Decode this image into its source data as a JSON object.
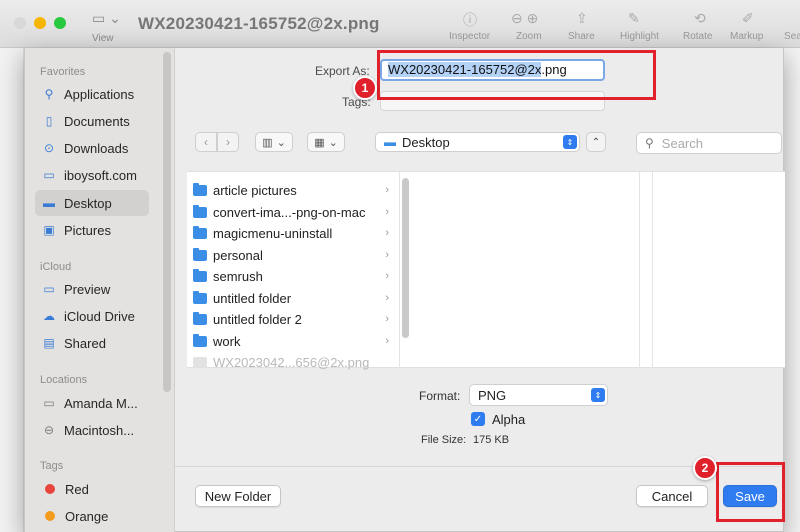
{
  "window": {
    "title": "WX20230421-165752@2x.png",
    "view_label": "View",
    "toolbar": [
      {
        "label": "Inspector",
        "icon": "info-icon"
      },
      {
        "label": "Zoom",
        "icon": "zoom-out-icon"
      },
      {
        "label": "Share",
        "icon": "share-icon"
      },
      {
        "label": "Highlight",
        "icon": "highlight-icon"
      },
      {
        "label": "Rotate",
        "icon": "rotate-icon"
      },
      {
        "label": "Markup",
        "icon": "markup-icon"
      },
      {
        "label": "Sear",
        "icon": "search-icon"
      }
    ]
  },
  "sidebar": {
    "sections": {
      "favorites": "Favorites",
      "icloud": "iCloud",
      "locations": "Locations",
      "tags": "Tags"
    },
    "favorites": [
      {
        "label": "Applications",
        "icon": "applications-icon"
      },
      {
        "label": "Documents",
        "icon": "documents-icon"
      },
      {
        "label": "Downloads",
        "icon": "downloads-icon"
      },
      {
        "label": "iboysoft.com",
        "icon": "folder-icon"
      },
      {
        "label": "Desktop",
        "icon": "desktop-icon",
        "active": true
      },
      {
        "label": "Pictures",
        "icon": "pictures-icon"
      }
    ],
    "icloud": [
      {
        "label": "Preview",
        "icon": "folder-icon"
      },
      {
        "label": "iCloud Drive",
        "icon": "cloud-icon"
      },
      {
        "label": "Shared",
        "icon": "shared-icon"
      }
    ],
    "locations": [
      {
        "label": "Amanda M...",
        "icon": "laptop-icon"
      },
      {
        "label": "Macintosh...",
        "icon": "disk-icon"
      }
    ],
    "tags": [
      {
        "label": "Red",
        "color": "#e8453c"
      },
      {
        "label": "Orange",
        "color": "#f39c1e"
      }
    ]
  },
  "save_dialog": {
    "export_as_label": "Export As:",
    "filename_selected": "WX20230421-165752@2x",
    "filename_ext": ".png",
    "tags_label": "Tags:",
    "location": "Desktop",
    "search_placeholder": "Search",
    "files": [
      {
        "name": "article pictures",
        "type": "folder"
      },
      {
        "name": "convert-ima...-png-on-mac",
        "type": "folder"
      },
      {
        "name": "magicmenu-uninstall",
        "type": "folder"
      },
      {
        "name": "personal",
        "type": "folder"
      },
      {
        "name": "semrush",
        "type": "folder"
      },
      {
        "name": "untitled folder",
        "type": "folder"
      },
      {
        "name": "untitled folder 2",
        "type": "folder"
      },
      {
        "name": "work",
        "type": "folder"
      },
      {
        "name": "WX2023042...656@2x.png",
        "type": "file"
      }
    ],
    "format_label": "Format:",
    "format_value": "PNG",
    "alpha_label": "Alpha",
    "alpha_checked": true,
    "file_size_label": "File Size:",
    "file_size_value": "175 KB",
    "new_folder_label": "New Folder",
    "cancel_label": "Cancel",
    "save_label": "Save"
  },
  "annotations": {
    "step1": "1",
    "step2": "2",
    "color": "#e0212b"
  }
}
